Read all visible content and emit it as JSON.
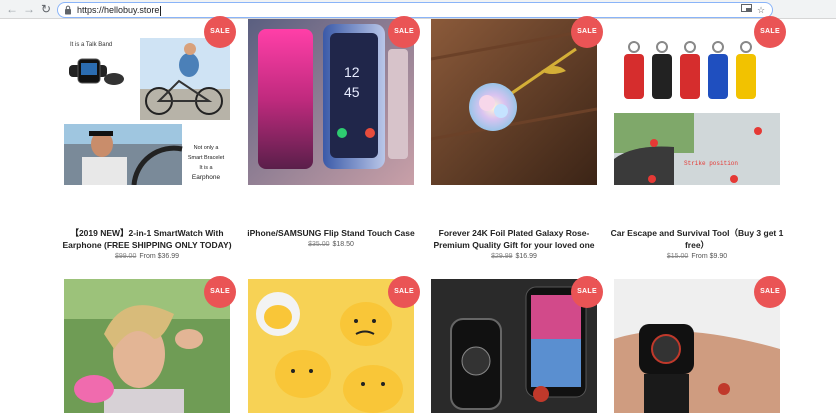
{
  "browser": {
    "url": "https://hellobuy.store"
  },
  "products": [
    {
      "badge": "SALE",
      "title": "【2019 NEW】2-in-1 SmartWatch With Earphone (FREE SHIPPING ONLY TODAY)",
      "old_price": "$99.00",
      "price": "From $36.99",
      "image_text": {
        "talk_band": "It is a Talk Band",
        "line1": "Not only a",
        "line2": "Smart Bracelet",
        "line3": "It is a",
        "line4": "Earphone"
      }
    },
    {
      "badge": "SALE",
      "title": "iPhone/SAMSUNG Flip Stand Touch Case",
      "old_price": "$35.00",
      "price": "$18.50"
    },
    {
      "badge": "SALE",
      "title": "Forever 24K Foil Plated Galaxy Rose- Premium Quality Gift for your loved one",
      "old_price": "$29.99",
      "price": "$16.99"
    },
    {
      "badge": "SALE",
      "title": "Car Escape and Survival Tool（Buy 3 get 1 free）",
      "old_price": "$15.00",
      "price": "From $9.90",
      "image_text": {
        "strike_position": "Strike position"
      }
    },
    {
      "badge": "SALE"
    },
    {
      "badge": "SALE"
    },
    {
      "badge": "SALE"
    },
    {
      "badge": "SALE"
    }
  ]
}
